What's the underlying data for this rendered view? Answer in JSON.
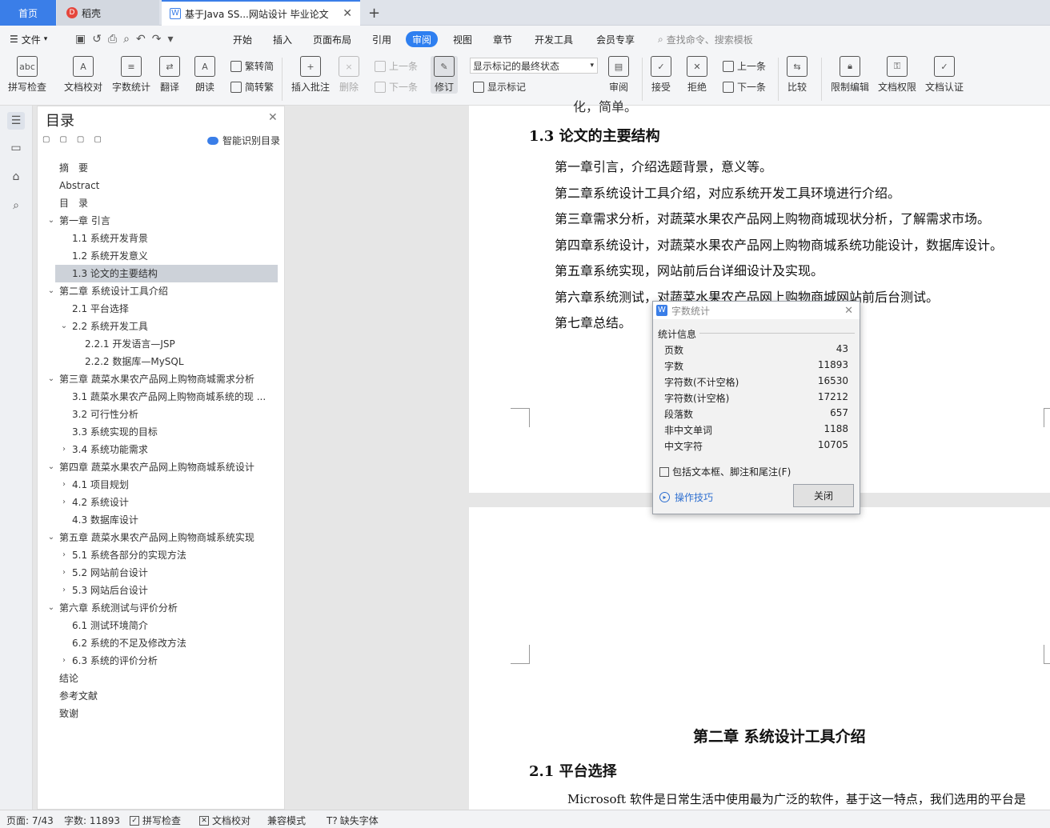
{
  "tabs": {
    "home": "首页",
    "daoke": "稻壳",
    "doc": "基于Java SS...网站设计 毕业论文"
  },
  "menu": {
    "file": "文件",
    "start": "开始",
    "insert": "插入",
    "layout": "页面布局",
    "ref": "引用",
    "review": "审阅",
    "view": "视图",
    "chapter": "章节",
    "dev": "开发工具",
    "member": "会员专享",
    "search": "查找命令、搜索模板"
  },
  "ribbon": {
    "spell": "拼写检查",
    "proof": "文档校对",
    "count": "字数统计",
    "translate": "翻译",
    "read": "朗读",
    "t2s": "繁转简",
    "s2t": "简转繁",
    "insert_comment": "插入批注",
    "delete": "删除",
    "prev": "上一条",
    "next": "下一条",
    "revise": "修订",
    "markup_state": "显示标记的最终状态",
    "show_markup": "显示标记",
    "review": "审阅",
    "accept": "接受",
    "reject": "拒绝",
    "prev2": "上一条",
    "next2": "下一条",
    "compare": "比较",
    "restrict": "限制编辑",
    "perm": "文档权限",
    "cert": "文档认证"
  },
  "toc": {
    "title": "目录",
    "smart": "智能识别目录",
    "items": [
      "摘　要",
      "Abstract",
      "目　录",
      "第一章 引言",
      "1.1  系统开发背景",
      "1.2  系统开发意义",
      "1.3 论文的主要结构",
      "第二章  系统设计工具介绍",
      "2.1  平台选择",
      "2.2  系统开发工具",
      "2.2.1  开发语言—JSP",
      "2.2.2  数据库—MySQL",
      "第三章  蔬菜水果农产品网上购物商城需求分析",
      "3.1  蔬菜水果农产品网上购物商城系统的现 ...",
      "3.2  可行性分析",
      "3.3  系统实现的目标",
      "3.4  系统功能需求",
      "第四章  蔬菜水果农产品网上购物商城系统设计",
      "4.1  项目规划",
      "4.2  系统设计",
      "4.3  数据库设计",
      "第五章  蔬菜水果农产品网上购物商城系统实现",
      "5.1  系统各部分的实现方法",
      "5.2  网站前台设计",
      "5.3 网站后台设计",
      "第六章  系统测试与评价分析",
      "6.1  测试环境简介",
      "6.2  系统的不足及修改方法",
      "6.3  系统的评价分析",
      "结论",
      "参考文献",
      "致谢"
    ]
  },
  "doc": {
    "top_fragment": "化，简单。",
    "heading": "1.3 论文的主要结构",
    "lines": [
      "第一章引言，介绍选题背景，意义等。",
      "第二章系统设计工具介绍，对应系统开发工具环境进行介绍。",
      "第三章需求分析，对蔬菜水果农产品网上购物商城现状分析，了解需求市场。",
      "第四章系统设计，对蔬菜水果农产品网上购物商城系统功能设计，数据库设计。",
      "第五章系统实现，网站前后台详细设计及实现。",
      "第六章系统测试，对蔬菜水果农产品网上购物商城网站前后台测试。",
      "第七章总结。"
    ],
    "chapter2": "第二章  系统设计工具介绍",
    "sec21": "2.1  平台选择",
    "para": "Microsoft 软件是日常生活中使用最为广泛的软件，基于这一特点，我们选用的平台是"
  },
  "dialog": {
    "title": "字数统计",
    "section": "统计信息",
    "rows": [
      {
        "k": "页数",
        "v": "43"
      },
      {
        "k": "字数",
        "v": "11893"
      },
      {
        "k": "字符数(不计空格)",
        "v": "16530"
      },
      {
        "k": "字符数(计空格)",
        "v": "17212"
      },
      {
        "k": "段落数",
        "v": "657"
      },
      {
        "k": "非中文单词",
        "v": "1188"
      },
      {
        "k": "中文字符",
        "v": "10705"
      }
    ],
    "include": "包括文本框、脚注和尾注(F)",
    "tips": "操作技巧",
    "close": "关闭"
  },
  "status": {
    "page": "页面: 7/43",
    "words": "字数: 11893",
    "spell": "拼写检查",
    "proof": "文档校对",
    "compat": "兼容模式",
    "font": "缺失字体"
  }
}
